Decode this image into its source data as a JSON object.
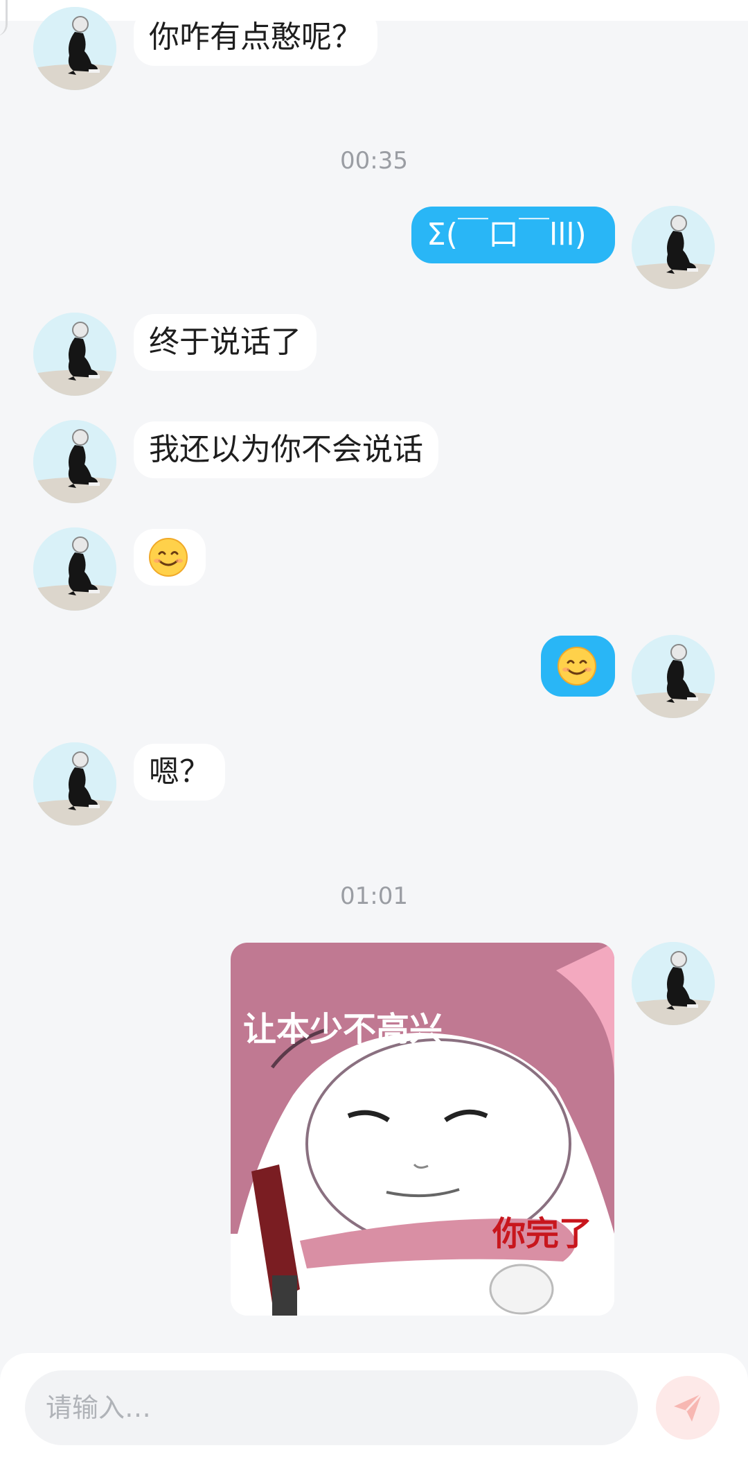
{
  "colors": {
    "background": "#f5f6f8",
    "incoming_bubble": "#ffffff",
    "outgoing_bubble": "#29b6f6",
    "timestamp_text": "#9a9da3",
    "send_button": "#fde9e8"
  },
  "messages": {
    "m1": "你咋有点憨呢？",
    "ts1": "00:35",
    "m2": "Σ(￣口￣lll)",
    "m3": "终于说话了",
    "m4": "我还以为你不会说话",
    "m5_emoji": "smiling-face-emoji",
    "m6_emoji": "smiling-face-emoji",
    "m7": "嗯？",
    "ts2": "01:01"
  },
  "sticker": {
    "icon": "pink-hood-meme-sticker",
    "caption_top": "让本少不高兴",
    "caption_bottom": "你完了"
  },
  "composer": {
    "placeholder": "请输入…",
    "value": "",
    "send_icon": "paper-plane-icon"
  }
}
